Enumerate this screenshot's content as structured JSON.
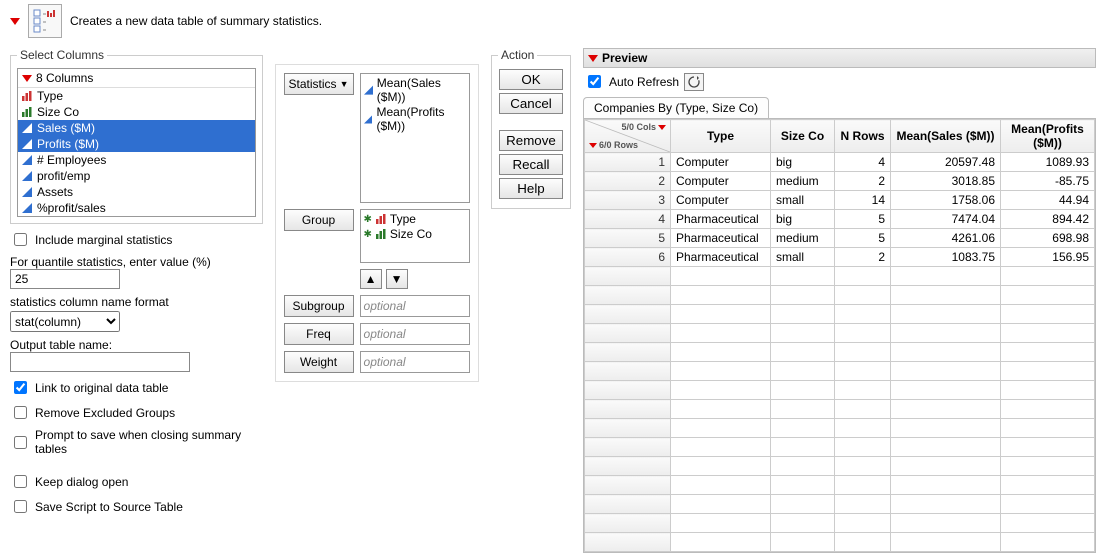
{
  "description": "Creates a new data table of summary statistics.",
  "select_columns": {
    "legend": "Select Columns",
    "header": "8 Columns",
    "items": [
      {
        "label": "Type",
        "icon": "red",
        "sel": false
      },
      {
        "label": "Size Co",
        "icon": "green",
        "sel": false
      },
      {
        "label": "Sales ($M)",
        "icon": "blue",
        "sel": true
      },
      {
        "label": "Profits ($M)",
        "icon": "blue",
        "sel": true
      },
      {
        "label": "# Employees",
        "icon": "blue",
        "sel": false
      },
      {
        "label": "profit/emp",
        "icon": "blue",
        "sel": false
      },
      {
        "label": "Assets",
        "icon": "blue",
        "sel": false
      },
      {
        "label": "%profit/sales",
        "icon": "blue",
        "sel": false
      }
    ]
  },
  "opts": {
    "include_marginal": "Include marginal statistics",
    "quantile_label": "For quantile statistics, enter value (%)",
    "quantile_value": "25",
    "colname_label": "statistics column name format",
    "colname_value": "stat(column)",
    "outname_label": "Output table name:",
    "outname_value": "",
    "link": "Link to original data table",
    "rmex": "Remove Excluded Groups",
    "prompt": "Prompt to save when closing summary tables",
    "keep": "Keep dialog open",
    "save_script": "Save Script to Source Table"
  },
  "roles": {
    "statistics_btn": "Statistics",
    "group_btn": "Group",
    "subgroup_btn": "Subgroup",
    "freq_btn": "Freq",
    "weight_btn": "Weight",
    "optional": "optional",
    "stats": [
      "Mean(Sales ($M))",
      "Mean(Profits ($M))"
    ],
    "groups": [
      "Type",
      "Size Co"
    ]
  },
  "action": {
    "legend": "Action",
    "ok": "OK",
    "cancel": "Cancel",
    "remove": "Remove",
    "recall": "Recall",
    "help": "Help"
  },
  "preview": {
    "title": "Preview",
    "auto_refresh": "Auto Refresh",
    "tab": "Companies By (Type, Size Co)",
    "corner_cols": "5/0 Cols",
    "corner_rows": "6/0 Rows",
    "headers": [
      "Type",
      "Size Co",
      "N Rows",
      "Mean(Sales ($M))",
      "Mean(Profits ($M))"
    ],
    "rows": [
      [
        "1",
        "Computer",
        "big",
        "4",
        "20597.48",
        "1089.93"
      ],
      [
        "2",
        "Computer",
        "medium",
        "2",
        "3018.85",
        "-85.75"
      ],
      [
        "3",
        "Computer",
        "small",
        "14",
        "1758.06",
        "44.94"
      ],
      [
        "4",
        "Pharmaceutical",
        "big",
        "5",
        "7474.04",
        "894.42"
      ],
      [
        "5",
        "Pharmaceutical",
        "medium",
        "5",
        "4261.06",
        "698.98"
      ],
      [
        "6",
        "Pharmaceutical",
        "small",
        "2",
        "1083.75",
        "156.95"
      ]
    ]
  }
}
